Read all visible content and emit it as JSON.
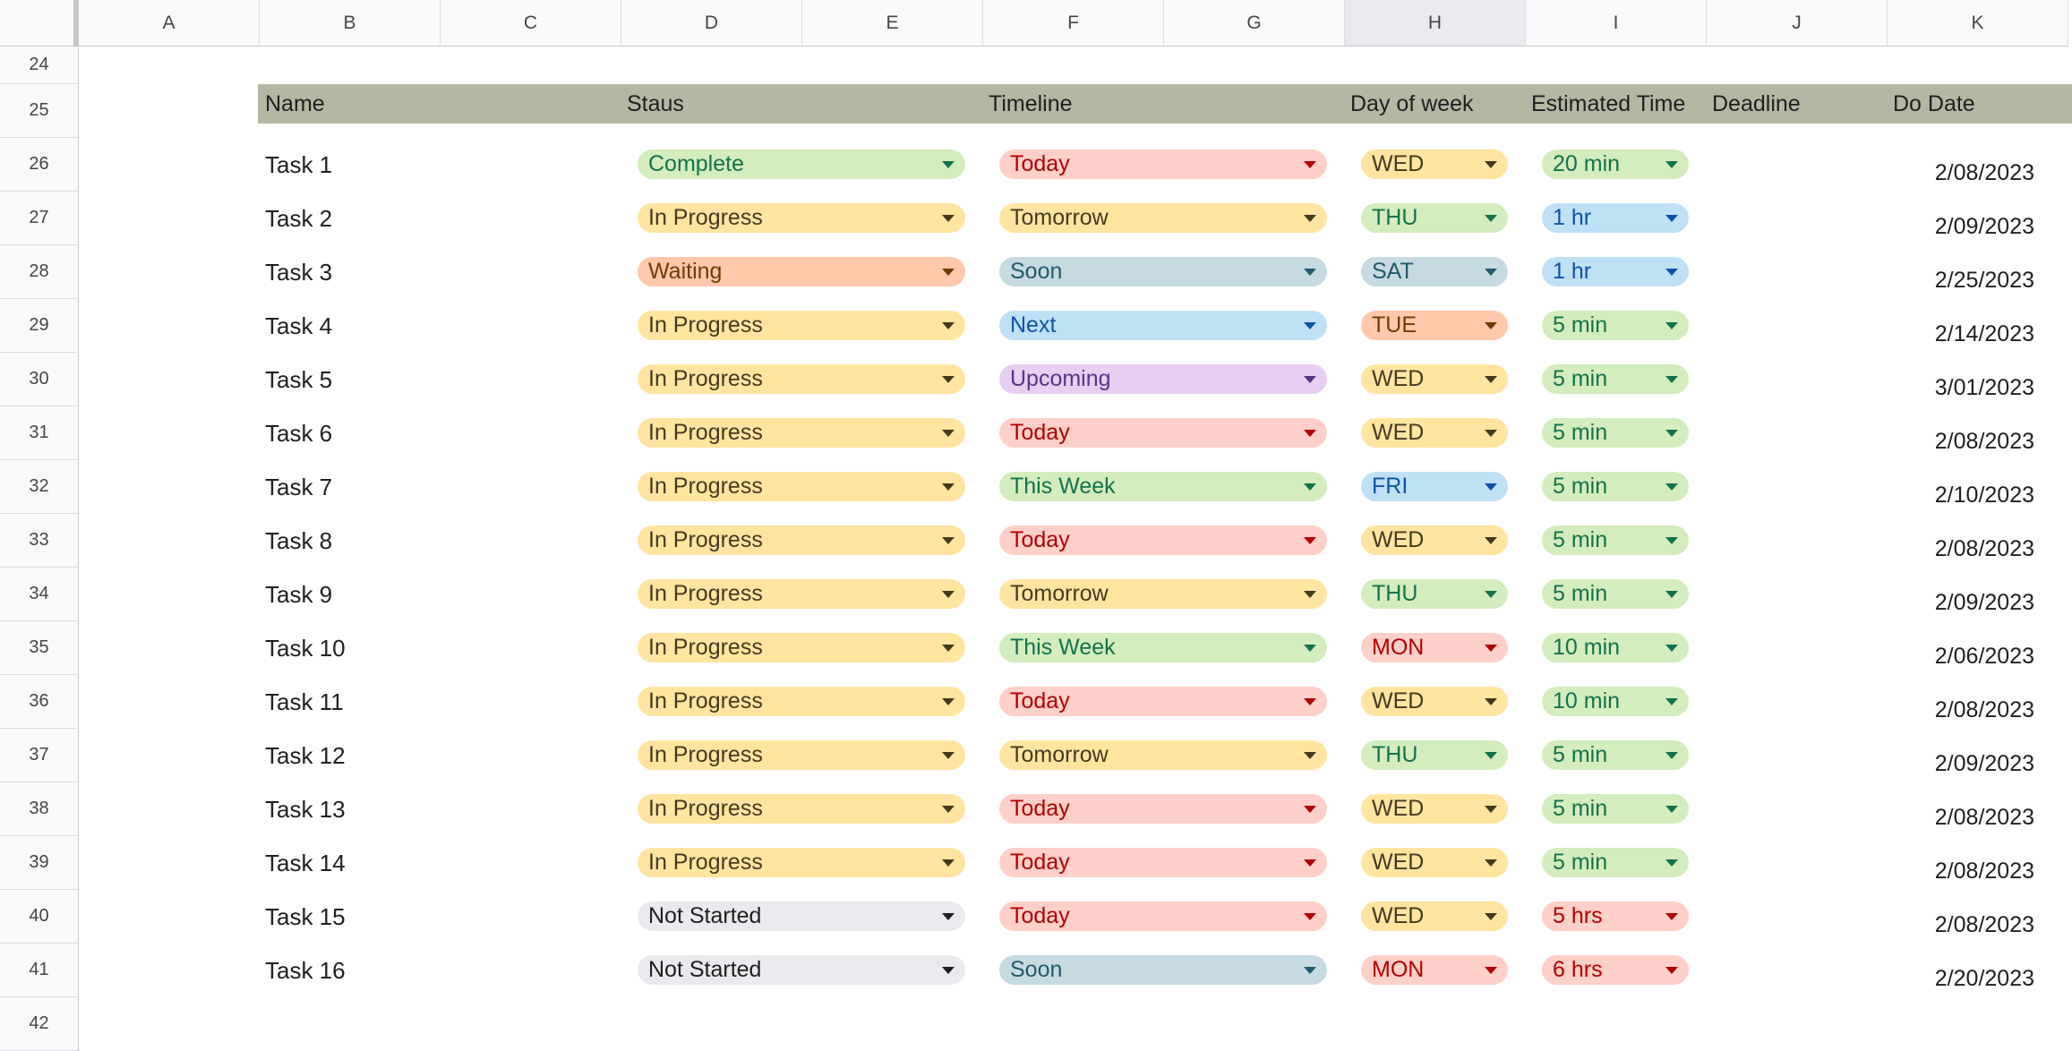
{
  "columns": [
    "A",
    "B",
    "C",
    "D",
    "E",
    "F",
    "G",
    "H",
    "I",
    "J",
    "K"
  ],
  "selected_column": "H",
  "row_numbers": [
    "24",
    "25",
    "26",
    "27",
    "28",
    "29",
    "30",
    "31",
    "32",
    "33",
    "34",
    "35",
    "36",
    "37",
    "38",
    "39",
    "40",
    "41",
    "42"
  ],
  "headers": {
    "name": "Name",
    "status": "Staus",
    "timeline": "Timeline",
    "day": "Day of week",
    "estimate": "Estimated Time",
    "deadline": "Deadline",
    "do_date": "Do Date"
  },
  "chip_colors": {
    "green": "#d4edbc",
    "yellow": "#ffe5a0",
    "orange": "#ffc8aa",
    "red": "#ffcfc9",
    "bluegray": "#c6dbe1",
    "blue": "#bfe1f6",
    "purple": "#e6cff2",
    "gray": "#e8eaed",
    "header_band": "#b4b8a3"
  },
  "tasks": [
    {
      "name": "Task 1",
      "status": "Complete",
      "status_color": "green",
      "timeline": "Today",
      "timeline_color": "red",
      "day": "WED",
      "day_color": "yellow",
      "estimate": "20 min",
      "estimate_color": "green",
      "deadline": "",
      "do_date": "2/08/2023"
    },
    {
      "name": "Task 2",
      "status": "In Progress",
      "status_color": "yellow",
      "timeline": "Tomorrow",
      "timeline_color": "yellow",
      "day": "THU",
      "day_color": "green",
      "estimate": "1 hr",
      "estimate_color": "blue",
      "deadline": "",
      "do_date": "2/09/2023"
    },
    {
      "name": "Task 3",
      "status": "Waiting",
      "status_color": "orange",
      "timeline": "Soon",
      "timeline_color": "bluegray",
      "day": "SAT",
      "day_color": "bluegray",
      "estimate": "1 hr",
      "estimate_color": "blue",
      "deadline": "",
      "do_date": "2/25/2023"
    },
    {
      "name": "Task 4",
      "status": "In Progress",
      "status_color": "yellow",
      "timeline": "Next",
      "timeline_color": "blue",
      "day": "TUE",
      "day_color": "orange",
      "estimate": "5 min",
      "estimate_color": "green",
      "deadline": "",
      "do_date": "2/14/2023"
    },
    {
      "name": "Task 5",
      "status": "In Progress",
      "status_color": "yellow",
      "timeline": "Upcoming",
      "timeline_color": "purple",
      "day": "WED",
      "day_color": "yellow",
      "estimate": "5 min",
      "estimate_color": "green",
      "deadline": "",
      "do_date": "3/01/2023"
    },
    {
      "name": "Task 6",
      "status": "In Progress",
      "status_color": "yellow",
      "timeline": "Today",
      "timeline_color": "red",
      "day": "WED",
      "day_color": "yellow",
      "estimate": "5 min",
      "estimate_color": "green",
      "deadline": "",
      "do_date": "2/08/2023"
    },
    {
      "name": "Task 7",
      "status": "In Progress",
      "status_color": "yellow",
      "timeline": "This Week",
      "timeline_color": "green",
      "day": "FRI",
      "day_color": "blue",
      "estimate": "5 min",
      "estimate_color": "green",
      "deadline": "",
      "do_date": "2/10/2023"
    },
    {
      "name": "Task 8",
      "status": "In Progress",
      "status_color": "yellow",
      "timeline": "Today",
      "timeline_color": "red",
      "day": "WED",
      "day_color": "yellow",
      "estimate": "5 min",
      "estimate_color": "green",
      "deadline": "",
      "do_date": "2/08/2023"
    },
    {
      "name": "Task 9",
      "status": "In Progress",
      "status_color": "yellow",
      "timeline": "Tomorrow",
      "timeline_color": "yellow",
      "day": "THU",
      "day_color": "green",
      "estimate": "5 min",
      "estimate_color": "green",
      "deadline": "",
      "do_date": "2/09/2023"
    },
    {
      "name": "Task 10",
      "status": "In Progress",
      "status_color": "yellow",
      "timeline": "This Week",
      "timeline_color": "green",
      "day": "MON",
      "day_color": "red",
      "estimate": "10 min",
      "estimate_color": "green",
      "deadline": "",
      "do_date": "2/06/2023"
    },
    {
      "name": "Task 11",
      "status": "In Progress",
      "status_color": "yellow",
      "timeline": "Today",
      "timeline_color": "red",
      "day": "WED",
      "day_color": "yellow",
      "estimate": "10 min",
      "estimate_color": "green",
      "deadline": "",
      "do_date": "2/08/2023"
    },
    {
      "name": "Task 12",
      "status": "In Progress",
      "status_color": "yellow",
      "timeline": "Tomorrow",
      "timeline_color": "yellow",
      "day": "THU",
      "day_color": "green",
      "estimate": "5 min",
      "estimate_color": "green",
      "deadline": "",
      "do_date": "2/09/2023"
    },
    {
      "name": "Task 13",
      "status": "In Progress",
      "status_color": "yellow",
      "timeline": "Today",
      "timeline_color": "red",
      "day": "WED",
      "day_color": "yellow",
      "estimate": "5 min",
      "estimate_color": "green",
      "deadline": "",
      "do_date": "2/08/2023"
    },
    {
      "name": "Task 14",
      "status": "In Progress",
      "status_color": "yellow",
      "timeline": "Today",
      "timeline_color": "red",
      "day": "WED",
      "day_color": "yellow",
      "estimate": "5 min",
      "estimate_color": "green",
      "deadline": "",
      "do_date": "2/08/2023"
    },
    {
      "name": "Task 15",
      "status": "Not Started",
      "status_color": "gray",
      "timeline": "Today",
      "timeline_color": "red",
      "day": "WED",
      "day_color": "yellow",
      "estimate": "5 hrs",
      "estimate_color": "red",
      "deadline": "",
      "do_date": "2/08/2023"
    },
    {
      "name": "Task 16",
      "status": "Not Started",
      "status_color": "gray",
      "timeline": "Soon",
      "timeline_color": "bluegray",
      "day": "MON",
      "day_color": "red",
      "estimate": "6 hrs",
      "estimate_color": "red",
      "deadline": "",
      "do_date": "2/20/2023"
    }
  ]
}
